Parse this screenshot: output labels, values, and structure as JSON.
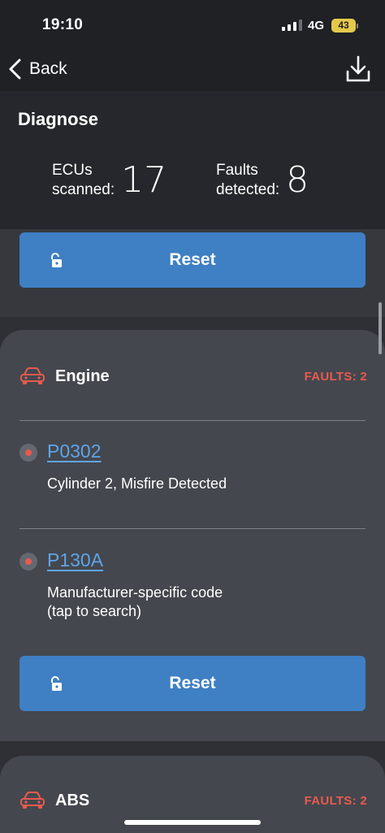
{
  "status_bar": {
    "time": "19:10",
    "network": "4G",
    "battery": "43"
  },
  "nav": {
    "back_label": "Back",
    "download_icon": "download-icon"
  },
  "header": {
    "title": "Diagnose",
    "ecus_label_1": "ECUs",
    "ecus_label_2": "scanned:",
    "ecus_value": "17",
    "faults_label_1": "Faults",
    "faults_label_2": "detected:",
    "faults_value": "8"
  },
  "top_section": {
    "reset_label": "Reset"
  },
  "ecus": [
    {
      "name": "Engine",
      "faults_label": "FAULTS: 2",
      "faults": [
        {
          "code": "P0302",
          "description_1": "Cylinder 2, Misfire Detected",
          "description_2": ""
        },
        {
          "code": "P130A",
          "description_1": "Manufacturer-specific code",
          "description_2": "(tap to search)"
        }
      ],
      "reset_label": "Reset"
    },
    {
      "name": "ABS",
      "faults_label": "FAULTS: 2"
    }
  ],
  "colors": {
    "accent_blue": "#3f7fc4",
    "fault_red": "#e85a4f",
    "link_blue": "#5fa4e8",
    "battery_yellow": "#e5c94a"
  }
}
